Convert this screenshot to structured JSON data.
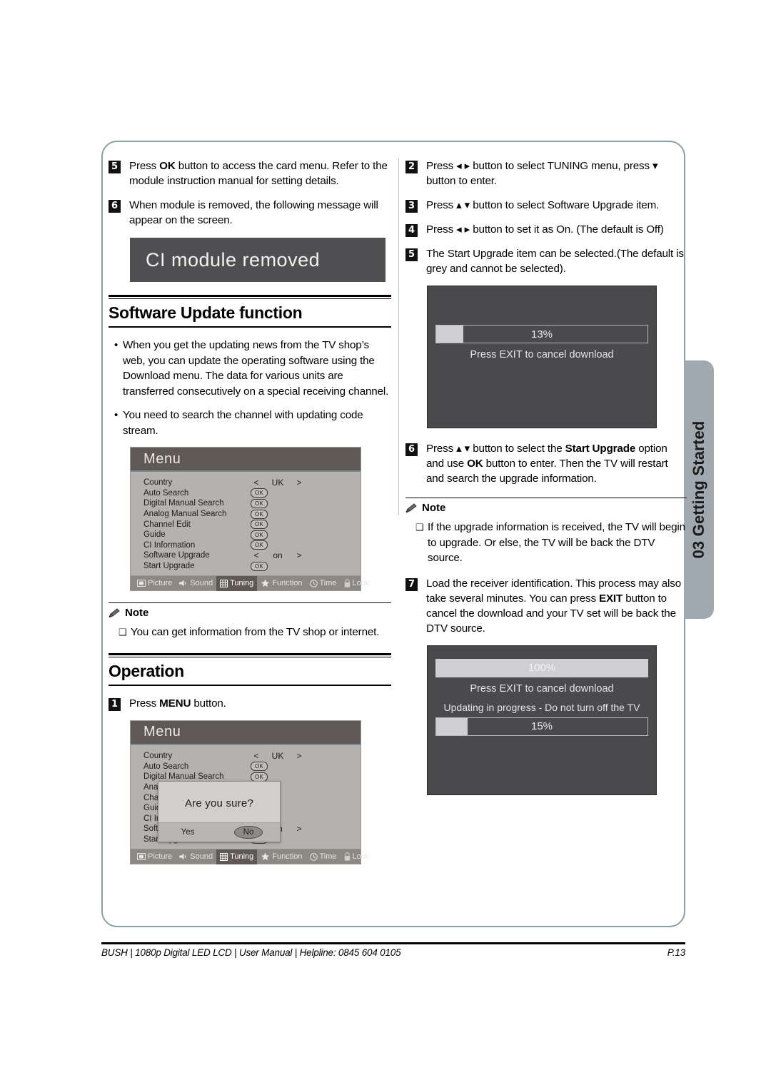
{
  "document": {
    "side_tab_label": "03 Getting Started",
    "footer_left": "BUSH | 1080p  Digital LED LCD | User Manual | Helpline: 0845 604 0105",
    "footer_page": "P.13"
  },
  "left_column": {
    "steps_top": [
      {
        "num": "5",
        "html": "Press <b>OK</b> button to access the card menu. Refer to the module instruction manual for setting details."
      },
      {
        "num": "6",
        "html": "When module is removed, the following message will appear on the screen."
      }
    ],
    "banner": {
      "text": "CI module removed"
    },
    "software_update": {
      "heading": "Software Update function",
      "bullets": [
        "When you get the updating news from the TV shop’s web, you can update the operating software using the Download menu. The data for various units are transferred consecutively on a special receiving channel.",
        "You need to search the channel with updating code stream."
      ]
    },
    "note": {
      "title": "Note",
      "items": [
        "You can get information from the TV shop or internet."
      ]
    },
    "operation": {
      "heading": "Operation",
      "steps": [
        {
          "num": "1",
          "html": "Press <b>MENU</b> button."
        }
      ]
    }
  },
  "osd_menu": {
    "title": "Menu",
    "rows": [
      {
        "label": "Country",
        "control": "arrows",
        "value": "UK",
        "left": "<",
        "right": ">"
      },
      {
        "label": "Auto Search",
        "control": "ok",
        "value": "OK"
      },
      {
        "label": "Digital Manual Search",
        "control": "ok",
        "value": "OK"
      },
      {
        "label": "Analog Manual Search",
        "control": "ok",
        "value": "OK"
      },
      {
        "label": "Channel Edit",
        "control": "ok",
        "value": "OK"
      },
      {
        "label": "Guide",
        "control": "ok",
        "value": "OK"
      },
      {
        "label": "CI Information",
        "control": "ok",
        "value": "OK"
      },
      {
        "label": "Software Upgrade",
        "control": "arrows",
        "value": "on",
        "left": "<",
        "right": ">"
      },
      {
        "label": "Start Upgrade",
        "control": "ok",
        "value": "OK"
      }
    ],
    "tabs": [
      {
        "label": "Picture",
        "icon": "picture-icon",
        "active": false
      },
      {
        "label": "Sound",
        "icon": "sound-icon",
        "active": false
      },
      {
        "label": "Tuning",
        "icon": "tuning-icon",
        "active": true
      },
      {
        "label": "Function",
        "icon": "function-star-icon",
        "active": false
      },
      {
        "label": "Time",
        "icon": "clock-icon",
        "active": false
      },
      {
        "label": "Lock",
        "icon": "lock-icon",
        "active": false
      }
    ]
  },
  "osd_menu_dialog": {
    "message": "Are you sure?",
    "yes_label": "Yes",
    "no_label": "No",
    "selected": "No"
  },
  "right_column": {
    "steps": [
      {
        "num": "2",
        "html": "Press ◂ ▸ button to select TUNING menu, press ▾ button to enter."
      },
      {
        "num": "3",
        "html": "Press ▴ ▾ button to select Software Upgrade item."
      },
      {
        "num": "4",
        "html": "Press ◂ ▸ button to set it as On. (The default is Off)"
      },
      {
        "num": "5",
        "html": "The Start Upgrade item can be selected.(The default is grey and cannot be selected)."
      }
    ],
    "steps_mid": [
      {
        "num": "6",
        "html": "Press ▴ ▾ button to select the <b>Start Upgrade</b> option and use <b>OK</b> button to enter. Then the TV will restart and search the upgrade information."
      }
    ],
    "note": {
      "title": "Note",
      "items": [
        "If the upgrade information is received, the TV will begin to upgrade. Or else, the TV will be back the DTV source."
      ]
    },
    "steps_bottom": [
      {
        "num": "7",
        "html": "Load the receiver identification. This process may also take several minutes. You can press <b>EXIT</b> button to cancel the download and your TV set will be back the DTV source."
      }
    ]
  },
  "download_screen_1": {
    "progress_label": "13%",
    "progress_percent": 13,
    "caption": "Press EXIT to cancel download"
  },
  "download_screen_2": {
    "progress_label_full": "100%",
    "progress_percent_full": 100,
    "caption_1": "Press EXIT to cancel download",
    "caption_2": "Updating in progress - Do not turn off the TV",
    "progress_label_2": "15%",
    "progress_percent_2": 15
  },
  "colors": {
    "frame_border": "#8aa0a4",
    "side_tab": "#a0a8b0",
    "osd_dark": "#4a4a4d",
    "osd_menu_bg": "#b5b1ae",
    "osd_header": "#5e5956",
    "banner_bg": "#4f4f52",
    "progress_fill": "#cfcfd2"
  }
}
